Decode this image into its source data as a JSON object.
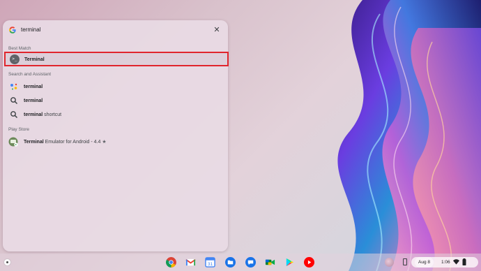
{
  "search": {
    "query": "terminal",
    "close_symbol": "✕"
  },
  "sections": {
    "best_match": "Best Match",
    "search_assistant": "Search and Assistant",
    "play_store": "Play Store"
  },
  "best_match": {
    "title": "Terminal",
    "icon_glyph": ">_"
  },
  "assistant_results": [
    {
      "icon": "assistant-icon",
      "bold": "terminal",
      "rest": ""
    },
    {
      "icon": "search-icon",
      "bold": "terminal",
      "rest": ""
    },
    {
      "icon": "search-icon",
      "bold": "terminal",
      "rest": " shortcut"
    }
  ],
  "play_store_result": {
    "bold": "Terminal",
    "rest": " Emulator for Android - 4.4 ",
    "star": "★"
  },
  "shelf": {
    "apps": [
      "chrome-icon",
      "gmail-icon",
      "calendar-icon",
      "files-icon",
      "messages-icon",
      "meet-icon",
      "play-store-icon",
      "youtube-icon"
    ],
    "date": "Aug 8",
    "time": "1:06"
  },
  "colors": {
    "highlight_border": "#e0252d"
  }
}
